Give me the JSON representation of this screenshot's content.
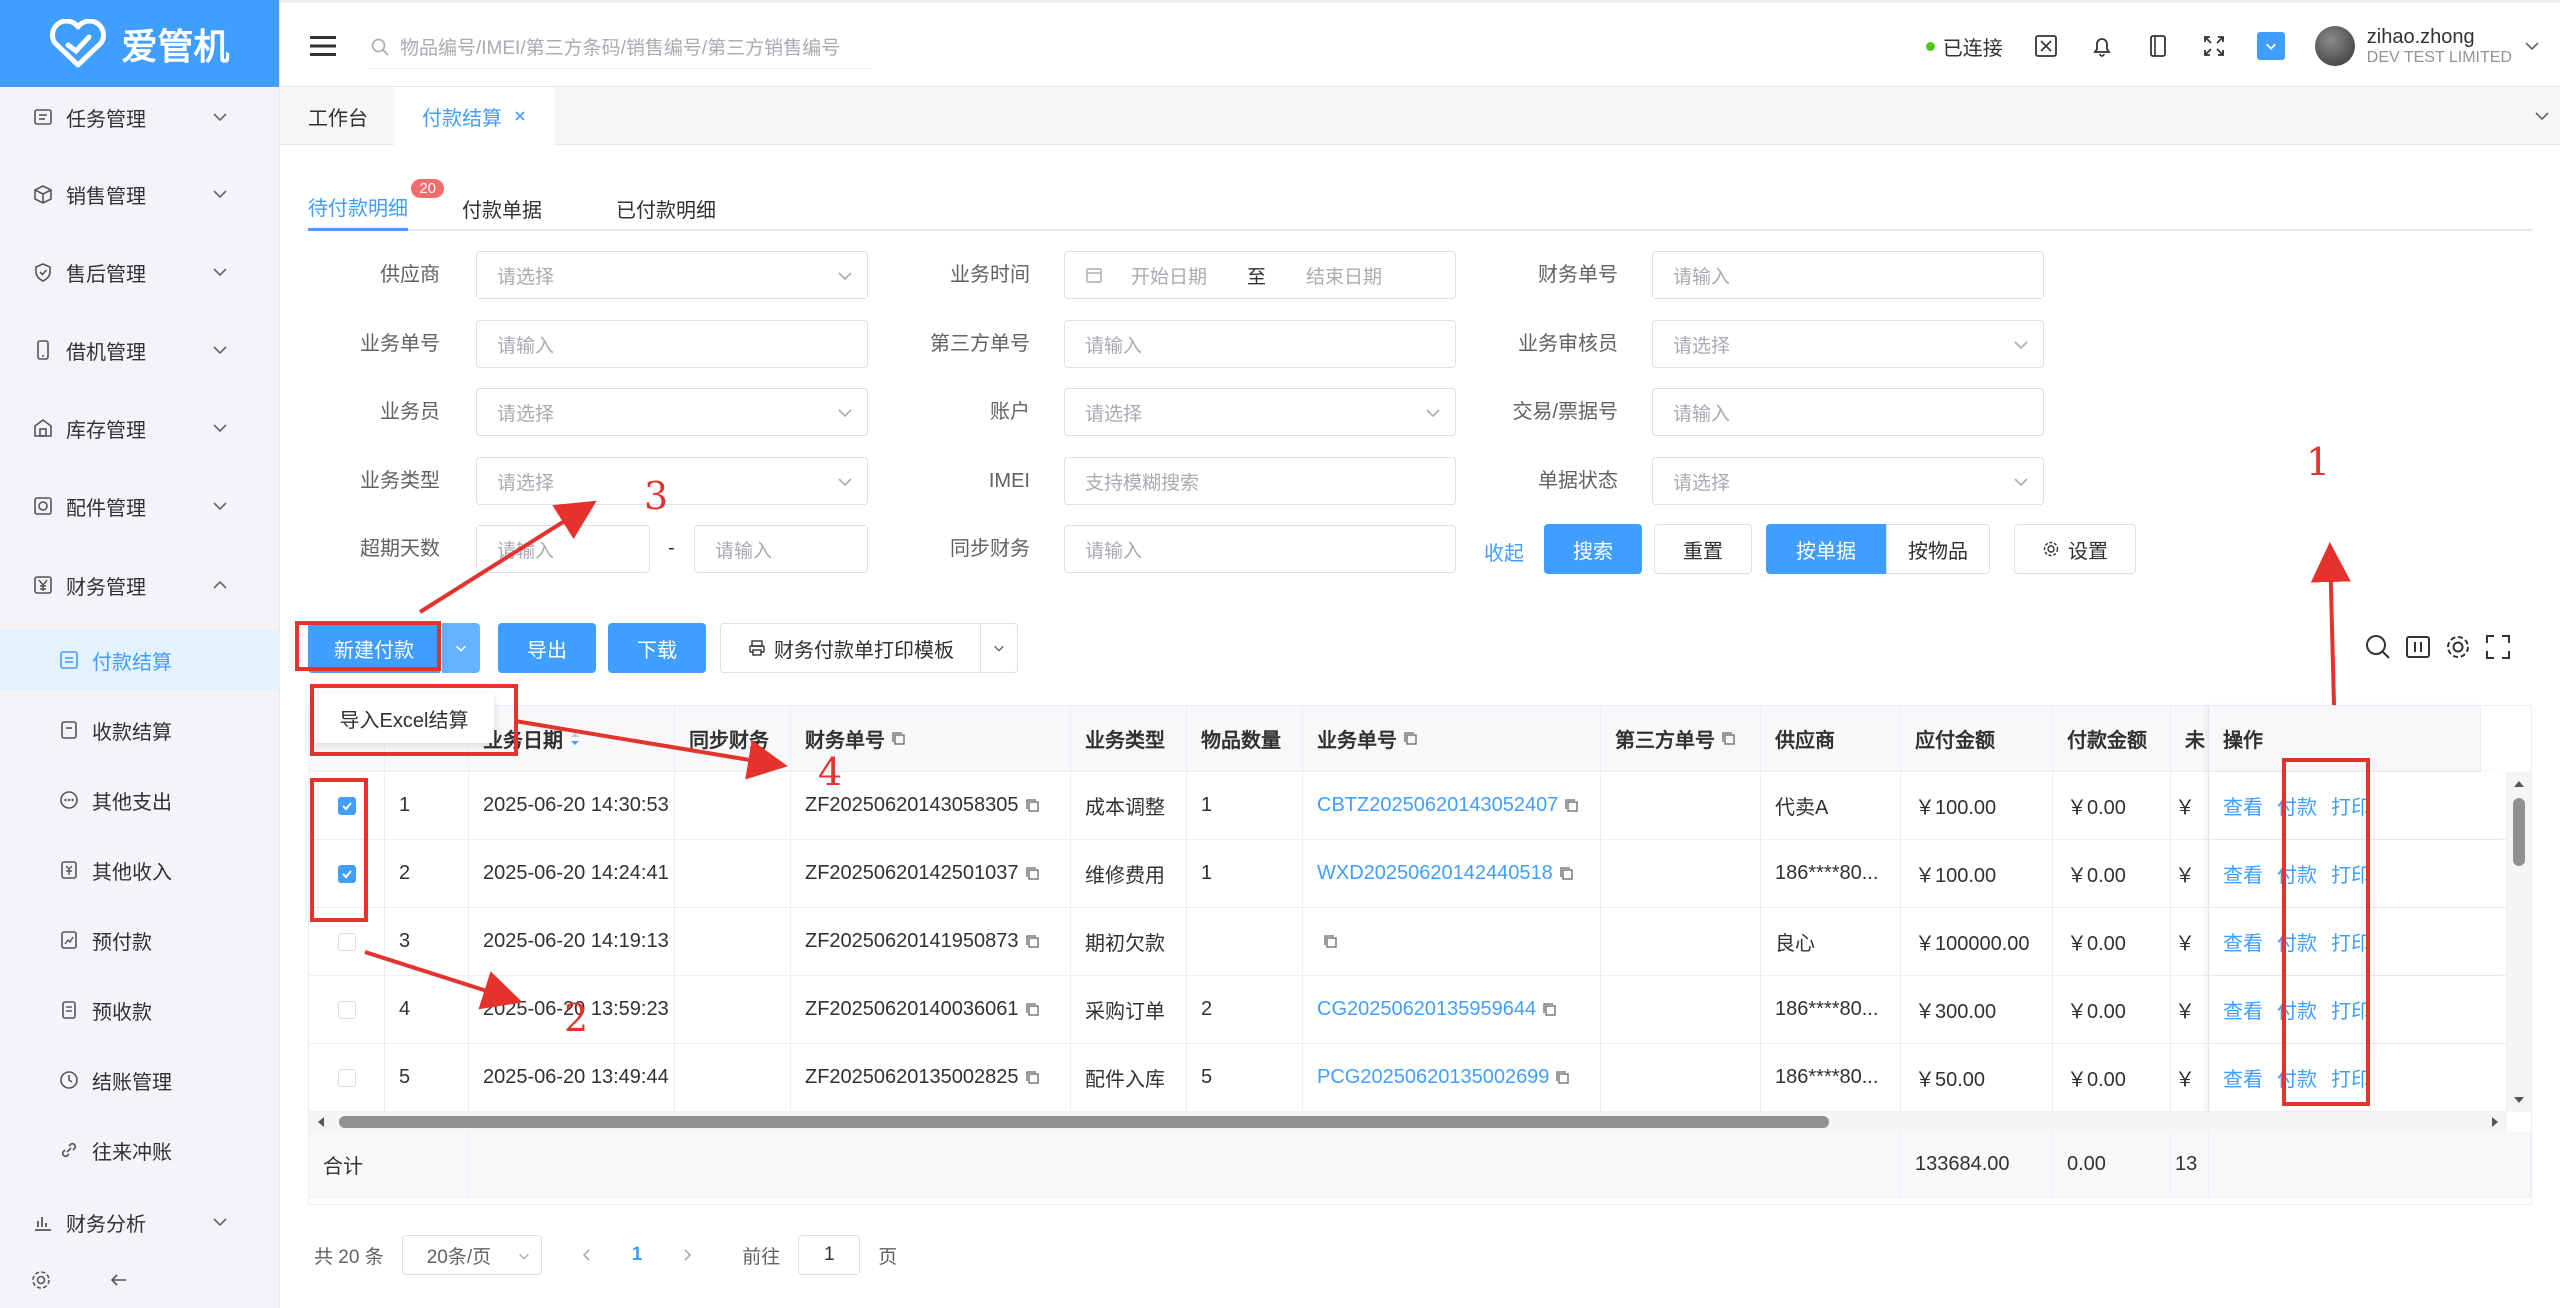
{
  "app": {
    "name": "爱管机"
  },
  "header": {
    "search_placeholder": "物品编号/IMEI/第三方条码/销售编号/第三方销售编号",
    "connection_status": "已连接",
    "user_name": "zihao.zhong",
    "company": "DEV TEST LIMITED"
  },
  "sidebar": {
    "items": [
      {
        "label": "任务管理"
      },
      {
        "label": "销售管理"
      },
      {
        "label": "售后管理"
      },
      {
        "label": "借机管理"
      },
      {
        "label": "库存管理"
      },
      {
        "label": "配件管理"
      },
      {
        "label": "财务管理"
      }
    ],
    "subitems": [
      {
        "label": "付款结算"
      },
      {
        "label": "收款结算"
      },
      {
        "label": "其他支出"
      },
      {
        "label": "其他收入"
      },
      {
        "label": "预付款"
      },
      {
        "label": "预收款"
      },
      {
        "label": "结账管理"
      },
      {
        "label": "往来冲账"
      }
    ],
    "analysis": "财务分析"
  },
  "tabs": {
    "workbench": "工作台",
    "payment": "付款结算"
  },
  "subtabs": {
    "pending": "待付款明细",
    "pending_badge": "20",
    "bills": "付款单据",
    "paid": "已付款明细"
  },
  "filters": {
    "supplier": {
      "label": "供应商",
      "placeholder": "请选择"
    },
    "biz_time": {
      "label": "业务时间",
      "start": "开始日期",
      "sep": "至",
      "end": "结束日期"
    },
    "finance_no": {
      "label": "财务单号",
      "placeholder": "请输入"
    },
    "biz_no": {
      "label": "业务单号",
      "placeholder": "请输入"
    },
    "third_no": {
      "label": "第三方单号",
      "placeholder": "请输入"
    },
    "auditor": {
      "label": "业务审核员",
      "placeholder": "请选择"
    },
    "salesman": {
      "label": "业务员",
      "placeholder": "请选择"
    },
    "account": {
      "label": "账户",
      "placeholder": "请选择"
    },
    "trade_no": {
      "label": "交易/票据号",
      "placeholder": "请输入"
    },
    "biz_type": {
      "label": "业务类型",
      "placeholder": "请选择"
    },
    "imei": {
      "label": "IMEI",
      "placeholder": "支持模糊搜索"
    },
    "doc_status": {
      "label": "单据状态",
      "placeholder": "请选择"
    },
    "overdue": {
      "label": "超期天数",
      "placeholder_from": "请输入",
      "sep": "-",
      "placeholder_to": "请输入"
    },
    "sync": {
      "label": "同步财务",
      "placeholder": "请输入"
    }
  },
  "filter_actions": {
    "collapse": "收起",
    "search": "搜索",
    "reset": "重置",
    "by_doc": "按单据",
    "by_item": "按物品",
    "settings": "设置"
  },
  "toolbar": {
    "new_payment": "新建付款",
    "export": "导出",
    "download": "下载",
    "print_template": "财务付款单打印模板",
    "dropdown_item": "导入Excel结算"
  },
  "table": {
    "headers": {
      "biz_date": "业务日期",
      "sync": "同步财务",
      "finance_no": "财务单号",
      "biz_type": "业务类型",
      "qty": "物品数量",
      "biz_no": "业务单号",
      "third_no": "第三方单号",
      "supplier": "供应商",
      "payable": "应付金额",
      "paid": "付款金额",
      "unpaid": "未",
      "ops": "操作"
    },
    "rows": [
      {
        "idx": "1",
        "date": "2025-06-20 14:30:53",
        "finance_no": "ZF20250620143058305",
        "type": "成本调整",
        "qty": "1",
        "biz_no": "CBTZ20250620143052407",
        "supplier": "代卖A",
        "payable": "￥100.00",
        "paid": "￥0.00",
        "unpaid": "￥",
        "checked": true
      },
      {
        "idx": "2",
        "date": "2025-06-20 14:24:41",
        "finance_no": "ZF20250620142501037",
        "type": "维修费用",
        "qty": "1",
        "biz_no": "WXD20250620142440518",
        "supplier": "186****80...",
        "payable": "￥100.00",
        "paid": "￥0.00",
        "unpaid": "￥",
        "checked": true
      },
      {
        "idx": "3",
        "date": "2025-06-20 14:19:13",
        "finance_no": "ZF20250620141950873",
        "type": "期初欠款",
        "qty": "",
        "biz_no": "",
        "supplier": "良心",
        "payable": "￥100000.00",
        "paid": "￥0.00",
        "unpaid": "￥",
        "checked": false
      },
      {
        "idx": "4",
        "date": "2025-06-20 13:59:23",
        "finance_no": "ZF20250620140036061",
        "type": "采购订单",
        "qty": "2",
        "biz_no": "CG20250620135959644",
        "supplier": "186****80...",
        "payable": "￥300.00",
        "paid": "￥0.00",
        "unpaid": "￥",
        "checked": false
      },
      {
        "idx": "5",
        "date": "2025-06-20 13:49:44",
        "finance_no": "ZF20250620135002825",
        "type": "配件入库",
        "qty": "5",
        "biz_no": "PCG20250620135002699",
        "supplier": "186****80...",
        "payable": "￥50.00",
        "paid": "￥0.00",
        "unpaid": "￥",
        "checked": false
      }
    ],
    "ops": {
      "view": "查看",
      "pay": "付款",
      "print": "打印"
    },
    "summary": {
      "label": "合计",
      "payable": "133684.00",
      "paid": "0.00",
      "unpaid": "13"
    }
  },
  "pagination": {
    "total": "共 20 条",
    "page_size": "20条/页",
    "current": "1",
    "goto": "前往",
    "goto_value": "1",
    "page_unit": "页"
  },
  "annotations": [
    "1",
    "2",
    "3",
    "4"
  ],
  "colors": {
    "primary": "#409eff",
    "annotation": "#e5322d",
    "badge": "#f56c6c"
  }
}
